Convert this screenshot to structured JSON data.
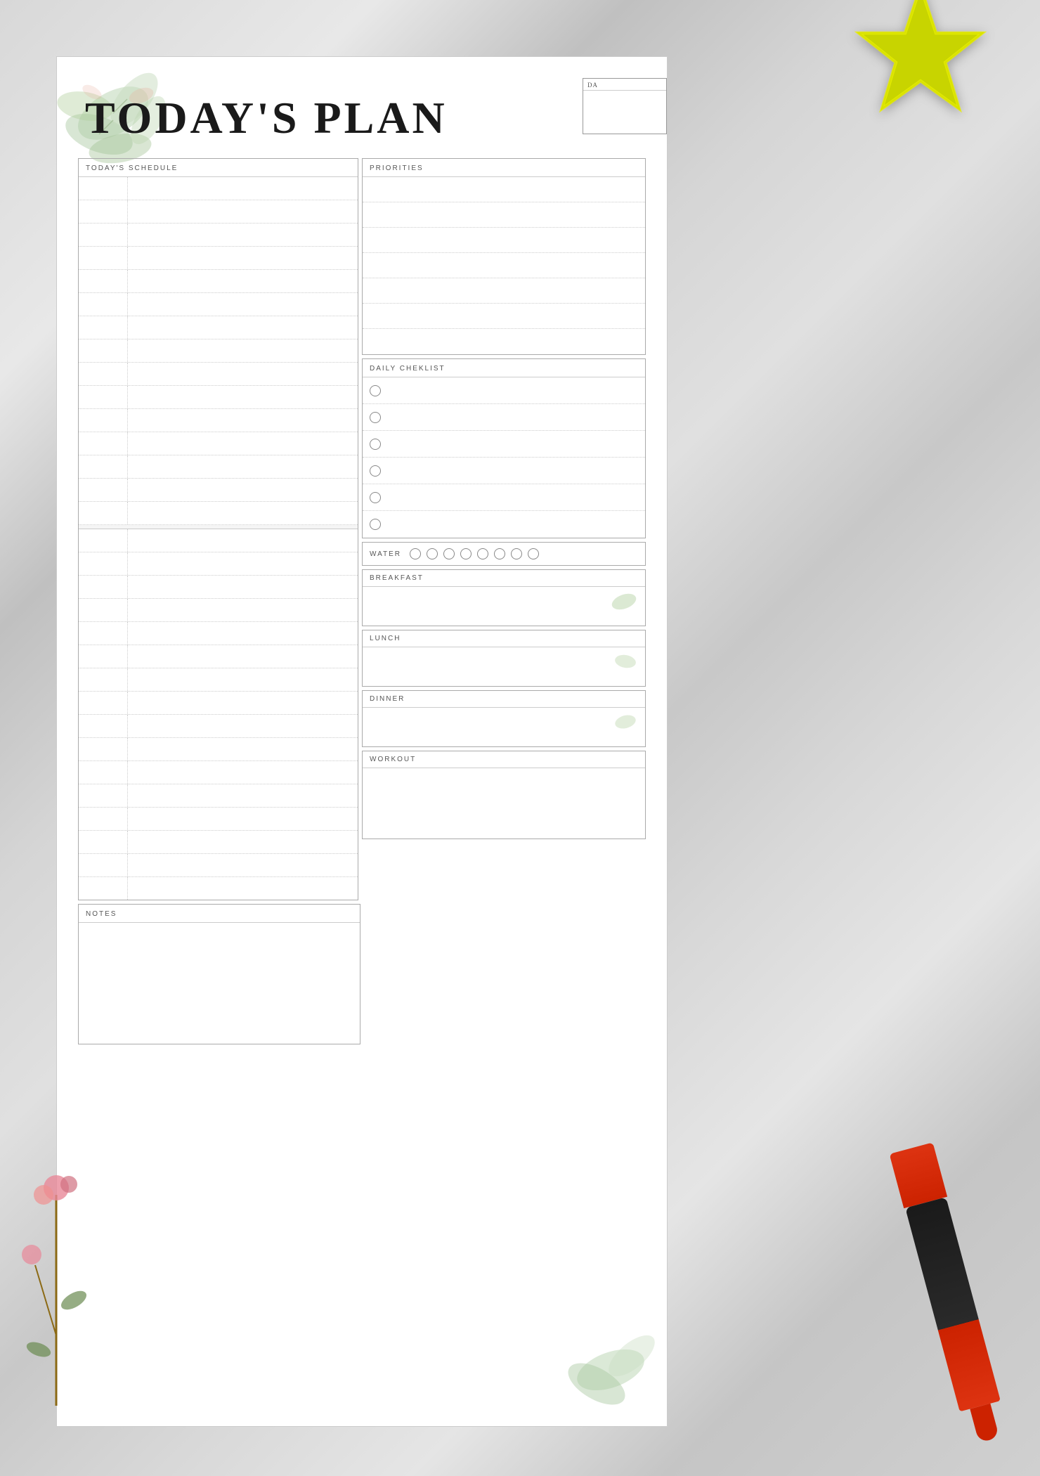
{
  "page": {
    "title": "TODAY'S PLAN",
    "date_label": "DATE",
    "background": "#c8c8c8"
  },
  "sections": {
    "schedule": {
      "label": "TODAY'S SCHEDULE",
      "rows": [
        {
          "time": "",
          "text": ""
        },
        {
          "time": "",
          "text": ""
        },
        {
          "time": "",
          "text": ""
        },
        {
          "time": "",
          "text": ""
        },
        {
          "time": "",
          "text": ""
        },
        {
          "time": "",
          "text": ""
        },
        {
          "time": "",
          "text": ""
        },
        {
          "time": "",
          "text": ""
        },
        {
          "time": "",
          "text": ""
        },
        {
          "time": "",
          "text": ""
        },
        {
          "time": "",
          "text": ""
        },
        {
          "time": "",
          "text": ""
        },
        {
          "time": "",
          "text": ""
        },
        {
          "time": "",
          "text": ""
        },
        {
          "time": "",
          "text": ""
        },
        {
          "time": "",
          "text": ""
        },
        {
          "time": "",
          "text": ""
        },
        {
          "time": "",
          "text": ""
        },
        {
          "time": "",
          "text": ""
        },
        {
          "time": "",
          "text": ""
        },
        {
          "time": "",
          "text": ""
        },
        {
          "time": "",
          "text": ""
        },
        {
          "time": "",
          "text": ""
        },
        {
          "time": "",
          "text": ""
        },
        {
          "time": "",
          "text": ""
        },
        {
          "time": "",
          "text": ""
        },
        {
          "time": "",
          "text": ""
        },
        {
          "time": "",
          "text": ""
        },
        {
          "time": "",
          "text": ""
        },
        {
          "time": "",
          "text": ""
        }
      ]
    },
    "priorities": {
      "label": "PRIORITIES",
      "rows": [
        "",
        "",
        "",
        "",
        "",
        "",
        ""
      ]
    },
    "checklist": {
      "label": "DAILY CHEKLIST",
      "items": [
        "",
        "",
        "",
        "",
        "",
        ""
      ]
    },
    "water": {
      "label": "WATER",
      "circles": 8
    },
    "breakfast": {
      "label": "BREAKFAST"
    },
    "lunch": {
      "label": "LUNCH"
    },
    "dinner": {
      "label": "DINNER"
    },
    "workout": {
      "label": "WORKOUT"
    },
    "notes": {
      "label": "NOTES"
    }
  }
}
